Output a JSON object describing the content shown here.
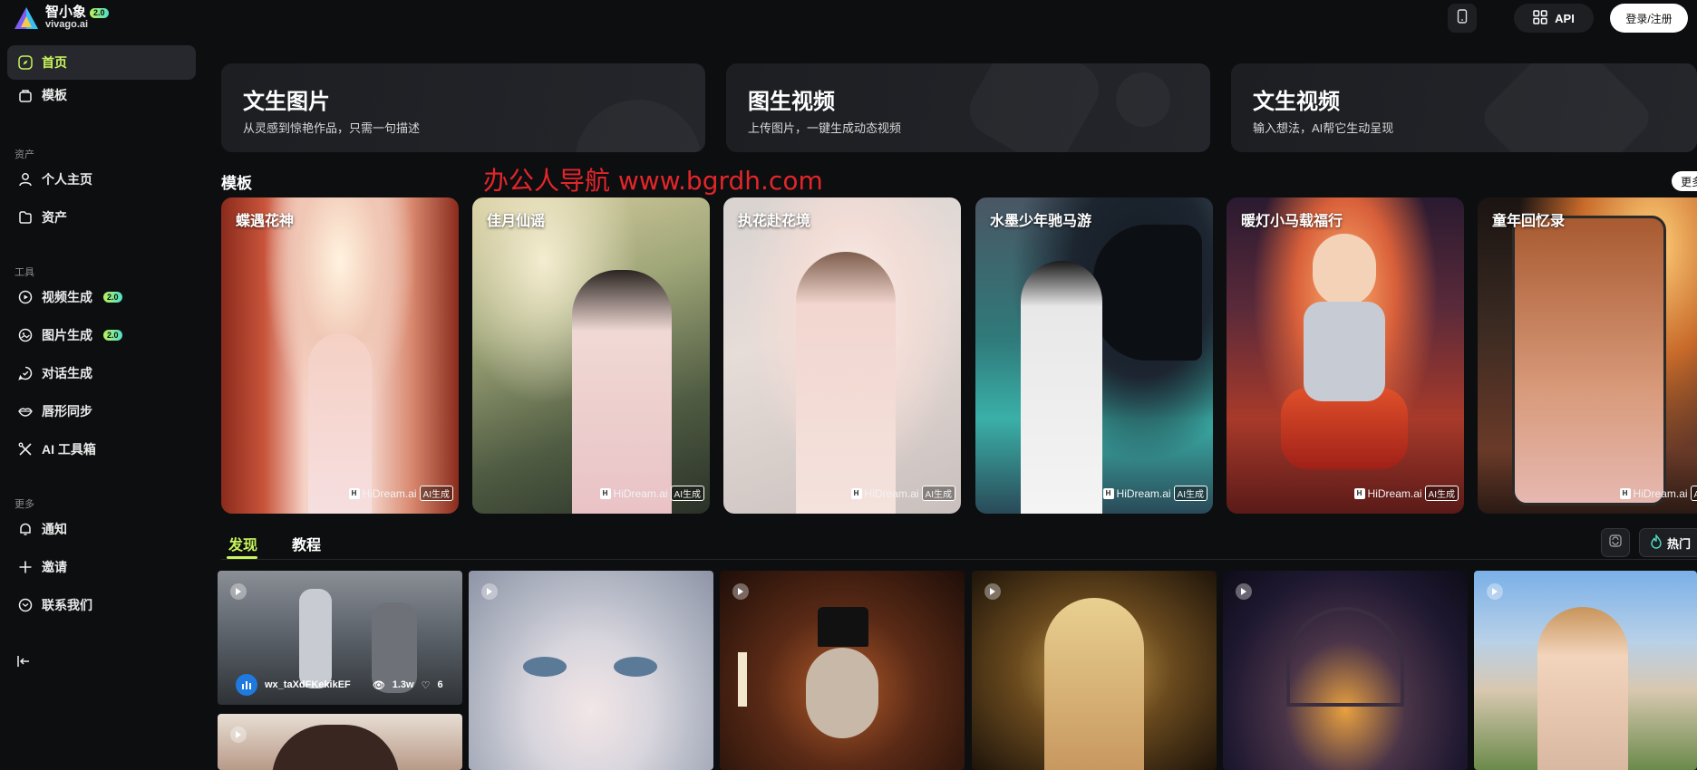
{
  "brand": {
    "name_cn": "智小象",
    "version": "2.0",
    "domain": "vivago.ai"
  },
  "header": {
    "api_label": "API",
    "login_label": "登录/注册"
  },
  "sidebar": {
    "main": [
      {
        "label": "首页",
        "icon": "compass-icon",
        "active": true
      },
      {
        "label": "模板",
        "icon": "template-icon"
      }
    ],
    "assets_label": "资产",
    "assets": [
      {
        "label": "个人主页",
        "icon": "user-icon"
      },
      {
        "label": "资产",
        "icon": "folder-icon"
      }
    ],
    "tools_label": "工具",
    "tools": [
      {
        "label": "视频生成",
        "icon": "video-icon",
        "badge": "2.0"
      },
      {
        "label": "图片生成",
        "icon": "image-icon",
        "badge": "2.0"
      },
      {
        "label": "对话生成",
        "icon": "chat-icon"
      },
      {
        "label": "唇形同步",
        "icon": "lips-icon"
      },
      {
        "label": "AI 工具箱",
        "icon": "tools-icon"
      }
    ],
    "more_label": "更多",
    "more": [
      {
        "label": "通知",
        "icon": "bell-icon"
      },
      {
        "label": "邀请",
        "icon": "plus-icon"
      },
      {
        "label": "联系我们",
        "icon": "mail-icon"
      }
    ]
  },
  "features": [
    {
      "title": "文生图片",
      "subtitle": "从灵感到惊艳作品，只需一句描述"
    },
    {
      "title": "图生视频",
      "subtitle": "上传图片，一键生成动态视频"
    },
    {
      "title": "文生视频",
      "subtitle": "输入想法，AI帮它生动呈现"
    }
  ],
  "templates": {
    "section_title": "模板",
    "more_label": "更多",
    "watermark_text": "办公人导航  www.bgrdh.com",
    "mark_text": "HiDream.ai",
    "mark_tag": "AI生成",
    "items": [
      {
        "title": "蝶遇花神"
      },
      {
        "title": "佳月仙谣"
      },
      {
        "title": "执花赴花境"
      },
      {
        "title": "水墨少年驰马游"
      },
      {
        "title": "暖灯小马载福行"
      },
      {
        "title": "童年回忆录"
      }
    ]
  },
  "feed": {
    "tabs": [
      {
        "label": "发现",
        "active": true
      },
      {
        "label": "教程"
      }
    ],
    "sort_label": "热门",
    "first_item": {
      "user": "wx_taXdFKekikEF",
      "views": "1.3w",
      "likes": "6"
    }
  },
  "colors": {
    "accent": "#c8f45c",
    "background": "#0d0e10",
    "watermark": "#e2262a"
  }
}
